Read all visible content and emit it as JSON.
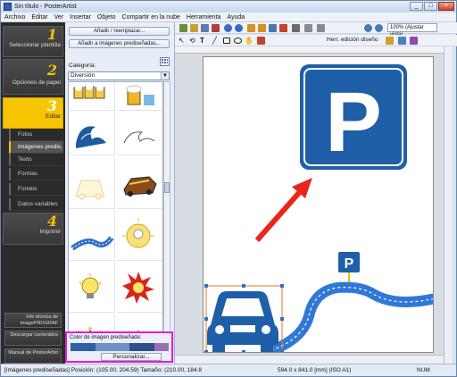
{
  "window": {
    "title": "Sin título - PosterArtist",
    "minimize": "_",
    "maximize": "□",
    "close": "×"
  },
  "menu": [
    "Archivo",
    "Editar",
    "Ver",
    "Insertar",
    "Objeto",
    "Compartir en la nube",
    "Herramienta",
    "Ayuda"
  ],
  "steps": [
    {
      "num": "1",
      "label": "Seleccionar plantilla"
    },
    {
      "num": "2",
      "label": "Opciones de papel"
    },
    {
      "num": "3",
      "label": "Editar"
    },
    {
      "num": "4",
      "label": "Imprimir"
    }
  ],
  "subitems": [
    "Fotos",
    "Imágenes predis.",
    "Texto",
    "Formas",
    "Fondos",
    "Datos variables"
  ],
  "sidebuttons": [
    "Info técnica de imagePROGRAF",
    "Descargar contenidos",
    "Manual de PosterArtist"
  ],
  "panel": {
    "add_replace": "Añadir / reemplazar...",
    "add_images": "Añadir a imágenes prediseñadas...",
    "category_label": "Categoría:",
    "category_value": "Diversión",
    "color_label": "Color de imagen prediseñada:",
    "customize": "Personalizar..."
  },
  "toolbar": {
    "zoom": "100% (Ajustar vista)",
    "design_tool": "Herr. edición diseño"
  },
  "colors": {
    "swatch1": "#2e5fa8",
    "swatch2": "#6f8fc6",
    "swatch3": "#2d4f8c",
    "swatch4": "#9b6fb5",
    "sign": "#1f5fa8",
    "arrow": "#e8261c"
  },
  "status": {
    "left": "[Imágenes prediseñadas] Posición: (105.00, 204.59) Tamaño: (210.00, 184.8",
    "size": "594.0 x 841.0 [mm] (ISO A1)",
    "num": "NUM"
  },
  "canvas": {
    "sign_letter": "P",
    "small_sign_letter": "P"
  }
}
